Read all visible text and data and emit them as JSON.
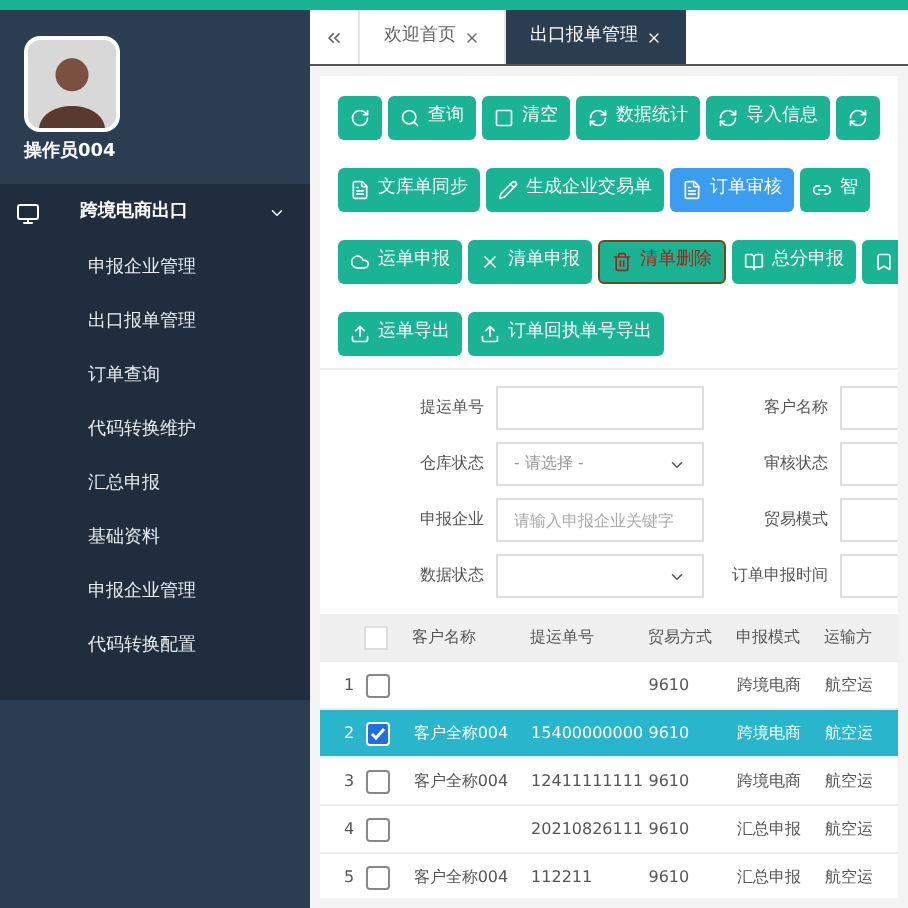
{
  "sidebar": {
    "user": "操作员004",
    "menu": {
      "label": "跨境电商出口",
      "expanded": true,
      "items": [
        "申报企业管理",
        "出口报单管理",
        "订单查询",
        "代码转换维护",
        "汇总申报",
        "基础资料",
        "申报企业管理",
        "代码转换配置"
      ]
    }
  },
  "tabs": [
    {
      "label": "欢迎首页",
      "selected": false
    },
    {
      "label": "出口报单管理",
      "selected": true
    }
  ],
  "toolbar_rows": [
    [
      {
        "kind": "primary"
      },
      {
        "label": "查询",
        "kind": "primary"
      },
      {
        "label": "清空",
        "kind": "primary"
      },
      {
        "label": "数据统计",
        "kind": "primary"
      },
      {
        "label": "导入信息",
        "kind": "primary"
      },
      {
        "kind": "primary"
      }
    ],
    [
      {
        "label": "文库单同步",
        "kind": "primary"
      },
      {
        "label": "生成企业交易单",
        "kind": "primary"
      },
      {
        "label": "订单审核",
        "kind": "info"
      },
      {
        "label": "智",
        "kind": "primary"
      }
    ],
    [
      {
        "label": "运单申报",
        "kind": "primary"
      },
      {
        "label": "清单申报",
        "kind": "primary"
      },
      {
        "label": "清单删除",
        "kind": "danger"
      },
      {
        "label": "总分申报",
        "kind": "primary"
      },
      {
        "kind": "primary"
      }
    ],
    [
      {
        "label": "运单导出",
        "kind": "primary"
      },
      {
        "label": "订单回执单号导出",
        "kind": "primary"
      }
    ]
  ],
  "filters": [
    {
      "label": "提运单号",
      "kind": "input"
    },
    {
      "label": "客户名称",
      "kind": "input"
    },
    {
      "label": "仓库状态",
      "kind": "select",
      "value": "- 请选择 -"
    },
    {
      "label": "审核状态",
      "kind": "input"
    },
    {
      "label": "申报企业",
      "kind": "input",
      "placeholder": "请输入申报企业关键字"
    },
    {
      "label": "贸易模式",
      "kind": "input"
    },
    {
      "label": "数据状态",
      "kind": "select"
    },
    {
      "label": "订单申报时间",
      "kind": "input"
    }
  ],
  "table": {
    "all_selected": false,
    "columns": [
      "客户名称",
      "提运单号",
      "贸易方式",
      "申报模式",
      "运输方"
    ],
    "rows": [
      {
        "index": "1",
        "selected": false,
        "cells": [
          "",
          "",
          "9610",
          "跨境电商",
          "航空运"
        ]
      },
      {
        "index": "2",
        "selected": true,
        "cells": [
          "客户全称004",
          "15400000000",
          "9610",
          "跨境电商",
          "航空运"
        ]
      },
      {
        "index": "3",
        "selected": false,
        "cells": [
          "客户全称004",
          "12411111111",
          "9610",
          "跨境电商",
          "航空运"
        ]
      },
      {
        "index": "4",
        "selected": false,
        "cells": [
          "",
          "20210826111",
          "9610",
          "汇总申报",
          "航空运"
        ]
      },
      {
        "index": "5",
        "selected": false,
        "cells": [
          "客户全称004",
          "112211",
          "9610",
          "汇总申报",
          "航空运"
        ]
      }
    ]
  }
}
